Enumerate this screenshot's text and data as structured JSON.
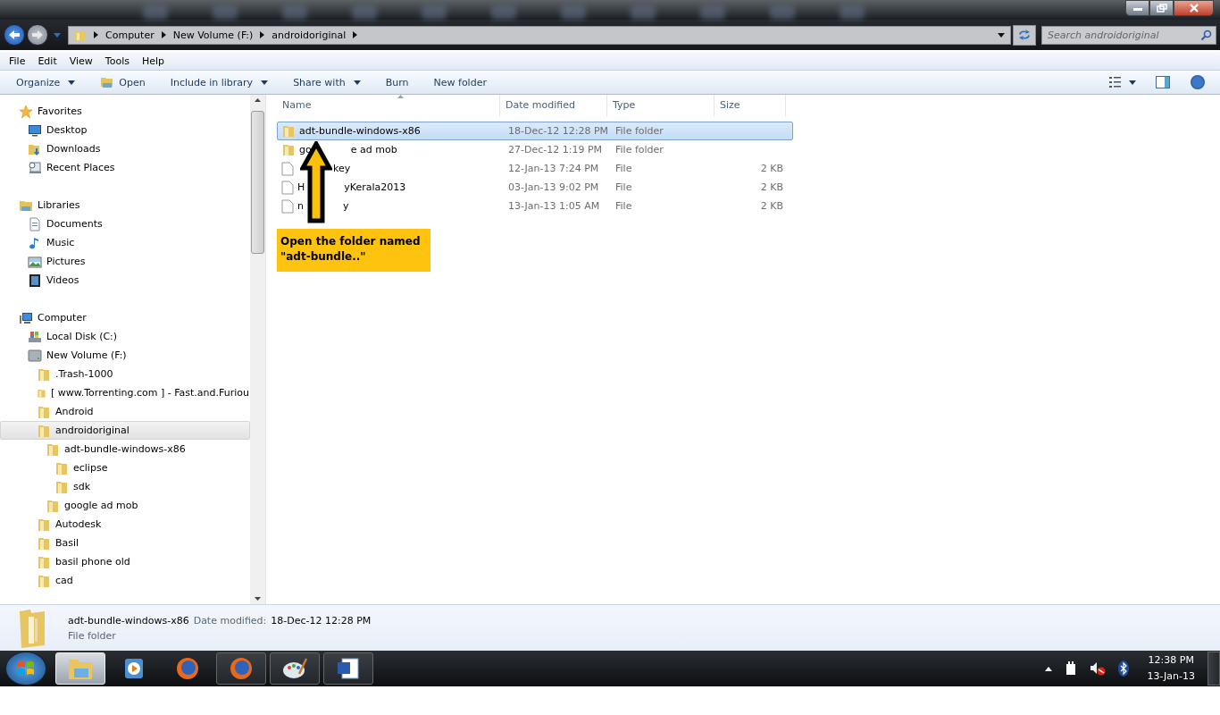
{
  "address_bar": {
    "path": [
      "Computer",
      "New Volume (F:)",
      "androidoriginal"
    ]
  },
  "search": {
    "placeholder": "Search androidoriginal"
  },
  "menu_bar": [
    "File",
    "Edit",
    "View",
    "Tools",
    "Help"
  ],
  "toolbar": [
    {
      "label": "Organize",
      "kind": "dropdown"
    },
    {
      "label": "Open",
      "kind": "open"
    },
    {
      "label": "Include in library",
      "kind": "dropdown"
    },
    {
      "label": "Share with",
      "kind": "dropdown"
    },
    {
      "label": "Burn",
      "kind": "plain"
    },
    {
      "label": "New folder",
      "kind": "plain"
    }
  ],
  "navigation_tree": [
    {
      "label": "Favorites",
      "kind": "star",
      "selected": false,
      "children": [
        {
          "label": "Desktop",
          "kind": "desktop",
          "selected": false
        },
        {
          "label": "Downloads",
          "kind": "downloads",
          "selected": false
        },
        {
          "label": "Recent Places",
          "kind": "recent",
          "selected": false
        }
      ]
    },
    {
      "label": "Libraries",
      "kind": "library",
      "selected": false,
      "children": [
        {
          "label": "Documents",
          "kind": "document",
          "selected": false
        },
        {
          "label": "Music",
          "kind": "music",
          "selected": false
        },
        {
          "label": "Pictures",
          "kind": "pictures",
          "selected": false
        },
        {
          "label": "Videos",
          "kind": "videos",
          "selected": false
        }
      ]
    },
    {
      "label": "Computer",
      "kind": "computer",
      "selected": false,
      "children": [
        {
          "label": "Local Disk (C:)",
          "kind": "disk",
          "selected": false
        },
        {
          "label": "New Volume (F:)",
          "kind": "drive",
          "selected": false,
          "children": [
            {
              "label": ".Trash-1000",
              "kind": "folder",
              "selected": false
            },
            {
              "label": "[ www.Torrenting.com ] - Fast.and.Furiou",
              "kind": "folder",
              "selected": false
            },
            {
              "label": "Android",
              "kind": "folder",
              "selected": false
            },
            {
              "label": "androidoriginal",
              "kind": "folder",
              "selected": true,
              "children": [
                {
                  "label": "adt-bundle-windows-x86",
                  "kind": "folder",
                  "selected": false,
                  "children": [
                    {
                      "label": "eclipse",
                      "kind": "folder",
                      "selected": false
                    },
                    {
                      "label": "sdk",
                      "kind": "folder",
                      "selected": false
                    }
                  ]
                },
                {
                  "label": "google ad mob",
                  "kind": "folder",
                  "selected": false
                }
              ]
            },
            {
              "label": "Autodesk",
              "kind": "folder",
              "selected": false
            },
            {
              "label": "Basil",
              "kind": "folder",
              "selected": false
            },
            {
              "label": "basil phone old",
              "kind": "folder",
              "selected": false
            },
            {
              "label": "cad",
              "kind": "folder",
              "selected": false
            }
          ]
        }
      ]
    }
  ],
  "file_list": {
    "columns": [
      "Name",
      "Date modified",
      "Type",
      "Size"
    ],
    "rows": [
      {
        "name_before": "adt-bundle-windows-x86",
        "kind": "folder",
        "selected": true,
        "date_modified": "18-Dec-12 12:28 PM",
        "type": "File folder"
      },
      {
        "name_before": "go",
        "name_after": "e ad mob",
        "kind": "folder",
        "selected": false,
        "date_modified": "27-Dec-12 1:19 PM",
        "type": "File folder"
      },
      {
        "name_after": "key",
        "kind": "file",
        "selected": false,
        "date_modified": "12-Jan-13 7:24 PM",
        "type": "File",
        "size": "2 KB"
      },
      {
        "name_before": "H",
        "name_after": "yKerala2013",
        "kind": "file",
        "selected": false,
        "date_modified": "03-Jan-13 9:02 PM",
        "type": "File",
        "size": "2 KB"
      },
      {
        "name_before": "n",
        "name_after": "y",
        "kind": "file",
        "selected": false,
        "date_modified": "13-Jan-13 1:05 AM",
        "type": "File",
        "size": "2 KB"
      }
    ]
  },
  "annotation": {
    "text": "Open the folder named \"adt-bundle..\""
  },
  "details_pane": {
    "name": "adt-bundle-windows-x86",
    "date_label": "Date modified:",
    "date_value": "18-Dec-12 12:28 PM",
    "type": "File folder"
  },
  "clock": {
    "time": "12:38 PM",
    "date": "13-Jan-13"
  }
}
